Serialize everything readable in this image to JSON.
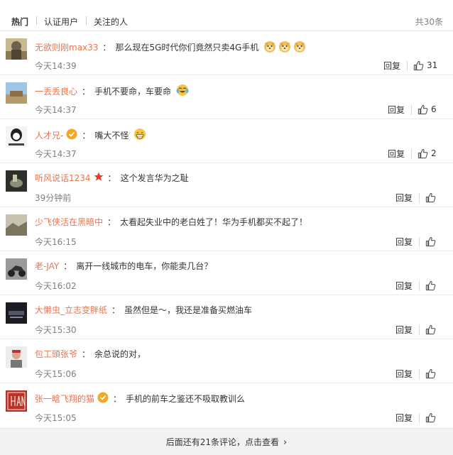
{
  "tabs": {
    "hot": "热门",
    "verified": "认证用户",
    "following": "关注的人",
    "total": "共30条"
  },
  "actions": {
    "reply": "回复"
  },
  "comments": [
    {
      "user": "无欲则刚max33",
      "text": "那么现在5G时代你们竟然只卖4G手机",
      "time": "今天14:39",
      "likes": "31",
      "emoji": [
        "doge-icon",
        "doge-icon",
        "doge-icon"
      ]
    },
    {
      "user": "一丢丢良心",
      "text": "手机不要命，车要命",
      "time": "今天14:37",
      "likes": "6",
      "emoji": [
        "laugh-cry-icon"
      ]
    },
    {
      "user": "人才兄-",
      "text": "嘴大不怪",
      "time": "今天14:37",
      "likes": "2",
      "badge": "verified-badge-icon",
      "emoji": [
        "grin-icon"
      ]
    },
    {
      "user": "听风说话1234",
      "text": "这个发言华为之耻",
      "time": "39分钟前",
      "likes": "",
      "badge": "star-badge-icon"
    },
    {
      "user": "少飞侠活在黑暗中",
      "text": "太看起失业中的老白姓了！华为手机都买不起了！",
      "time": "今天16:15",
      "likes": ""
    },
    {
      "user": "老-JAY",
      "text": "离开一线城市的电车，你能卖几台？",
      "time": "今天16:02",
      "likes": ""
    },
    {
      "user": "大懒虫_立志变胖纸",
      "text": "虽然但是～，我还是准备买燃油车",
      "time": "今天15:30",
      "likes": ""
    },
    {
      "user": "包工頭张爷",
      "text": "余总说的对，",
      "time": "今天15:06",
      "likes": ""
    },
    {
      "user": "张一晗飞翔的猫",
      "text": "手机的前车之鉴还不吸取教训么",
      "time": "今天15:05",
      "likes": "",
      "badge": "verified-badge-icon"
    }
  ],
  "footer": {
    "more": "后面还有21条评论，点击查看"
  },
  "colors": {
    "username": "#eb7350",
    "time": "#808080",
    "verified": "#f5a623",
    "star": "#e43c2e"
  }
}
